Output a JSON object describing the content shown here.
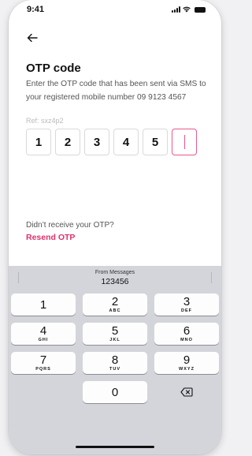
{
  "status_bar": {
    "time": "9:41",
    "icons": [
      "cellular-signal-icon",
      "wifi-icon",
      "battery-icon"
    ]
  },
  "nav": {
    "back_icon": "arrow-left-icon"
  },
  "otp": {
    "title": "OTP code",
    "description": "Enter the OTP code that has been sent via SMS to your registered mobile number 09 9123 4567",
    "ref": "Ref: sxz4p2",
    "digits": [
      "1",
      "2",
      "3",
      "4",
      "5",
      ""
    ]
  },
  "resend": {
    "prompt": "Didn’t receive your OTP?",
    "link": "Resend OTP"
  },
  "keyboard": {
    "suggestion_label": "From Messages",
    "suggestion_code": "123456",
    "keys": [
      {
        "num": "1",
        "letters": ""
      },
      {
        "num": "2",
        "letters": "ABC"
      },
      {
        "num": "3",
        "letters": "DEF"
      },
      {
        "num": "4",
        "letters": "GHI"
      },
      {
        "num": "5",
        "letters": "JKL"
      },
      {
        "num": "6",
        "letters": "MNO"
      },
      {
        "num": "7",
        "letters": "PQRS"
      },
      {
        "num": "8",
        "letters": "TUV"
      },
      {
        "num": "9",
        "letters": "WXYZ"
      },
      {
        "num": "0",
        "letters": ""
      }
    ],
    "delete_icon": "backspace-icon"
  },
  "colors": {
    "accent": "#e0306b",
    "active_border": "#e85a89",
    "keyboard_bg": "#d3d5da"
  }
}
